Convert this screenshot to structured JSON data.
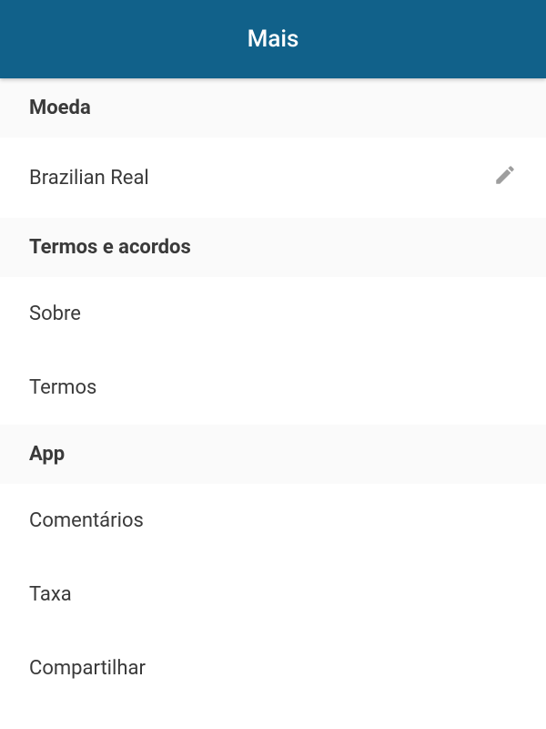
{
  "header": {
    "title": "Mais"
  },
  "sections": {
    "currency": {
      "header": "Moeda",
      "item_label": "Brazilian Real"
    },
    "terms": {
      "header": "Termos e acordos",
      "about_label": "Sobre",
      "terms_label": "Termos"
    },
    "app": {
      "header": "App",
      "comments_label": "Comentários",
      "rate_label": "Taxa",
      "share_label": "Compartilhar"
    }
  }
}
